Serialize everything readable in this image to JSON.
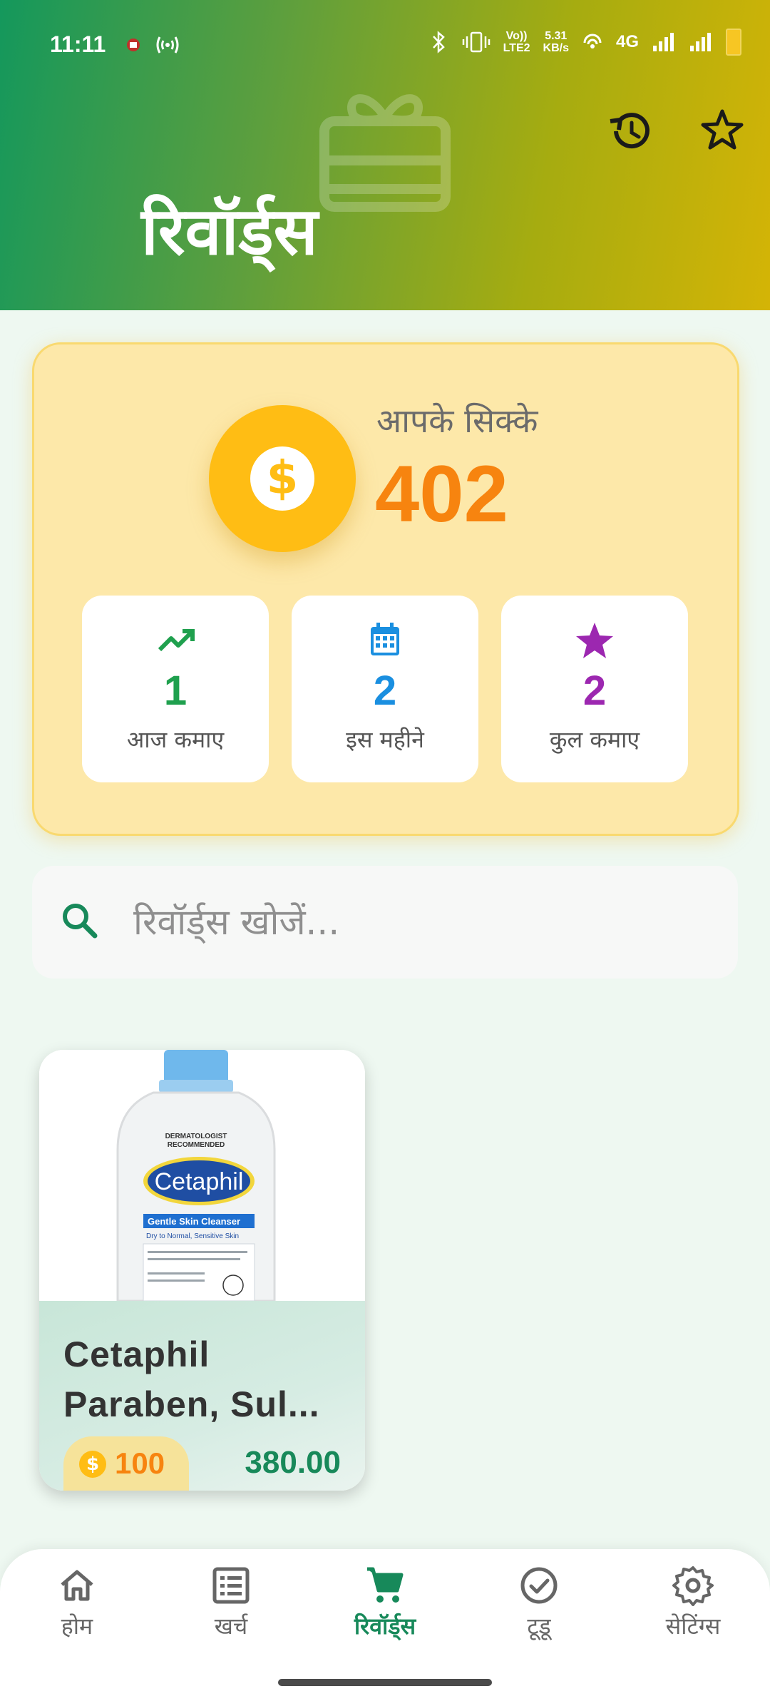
{
  "status_bar": {
    "time": "11:11",
    "network_label_top": "Vo))",
    "network_label_bottom": "LTE2",
    "speed_top": "5.31",
    "speed_bottom": "KB/s",
    "net_type": "4G"
  },
  "header": {
    "title": "रिवॉर्ड्स",
    "history_icon": "history-icon",
    "favorites_icon": "star-icon",
    "decor_icon": "gift-icon"
  },
  "coins": {
    "label": "आपके सिक्के",
    "value": "402",
    "coin_icon": "dollar-coin-icon",
    "stats": [
      {
        "value": "1",
        "label": "आज कमाए",
        "icon": "trending-up-icon",
        "color": "#1fa04e"
      },
      {
        "value": "2",
        "label": "इस महीने",
        "icon": "calendar-icon",
        "color": "#1a8fe0"
      },
      {
        "value": "2",
        "label": "कुल कमाए",
        "icon": "star-icon",
        "color": "#9c27b0"
      }
    ]
  },
  "search": {
    "placeholder": "रिवॉर्ड्स खोजें..."
  },
  "products": [
    {
      "name": "Cetaphil Paraben, Sul...",
      "coin_cost": "100",
      "price": "380.00",
      "brand": "Cetaphil",
      "image_text": [
        "DERMATOLOGIST",
        "RECOMMENDED",
        "Gentle Skin Cleanser",
        "Dry to Normal, Sensitive Skin"
      ]
    }
  ],
  "bottom_nav": [
    {
      "label": "होम",
      "icon": "home-icon",
      "active": false
    },
    {
      "label": "खर्च",
      "icon": "list-icon",
      "active": false
    },
    {
      "label": "रिवॉर्ड्स",
      "icon": "cart-icon",
      "active": true
    },
    {
      "label": "टूडू",
      "icon": "check-circle-icon",
      "active": false
    },
    {
      "label": "सेटिंग्स",
      "icon": "gear-icon",
      "active": false
    }
  ],
  "colors": {
    "accent_green": "#17895a",
    "coin_orange": "#f7840f",
    "coin_yellow": "#ffbd14"
  }
}
